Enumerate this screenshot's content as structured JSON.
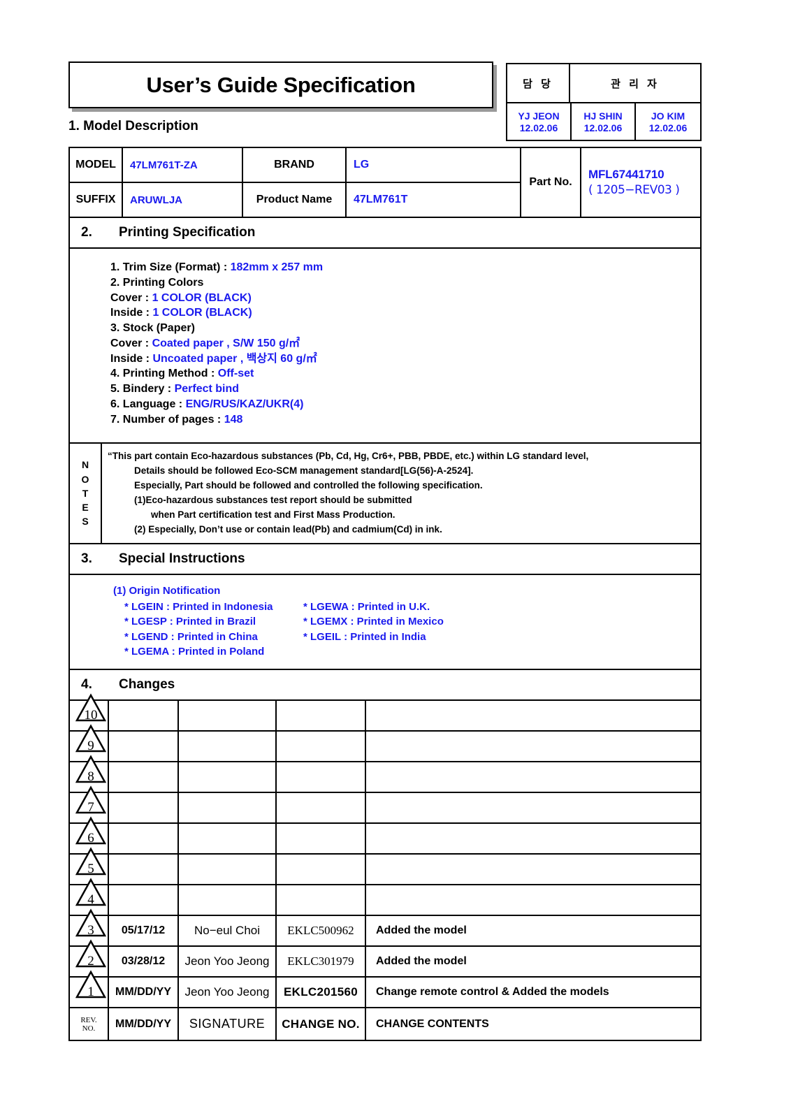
{
  "document": {
    "title": "User’s Guide Specification"
  },
  "approval": {
    "headers": [
      "담  당",
      "관 리 자"
    ],
    "people": [
      {
        "name": "YJ JEON",
        "date": "12.02.06"
      },
      {
        "name": "HJ SHIN",
        "date": "12.02.06"
      },
      {
        "name": "JO KIM",
        "date": "12.02.06"
      }
    ]
  },
  "section1": {
    "number": "1.",
    "title": "Model Description",
    "fields": {
      "model_label": "MODEL",
      "model_value": "47LM761T-ZA",
      "brand_label": "BRAND",
      "brand_value": "LG",
      "suffix_label": "SUFFIX",
      "suffix_value": "ARUWLJA",
      "product_name_label": "Product Name",
      "product_name_value": "47LM761T",
      "part_no_label": "Part No.",
      "part_no_value": "MFL67441710",
      "part_no_rev": "( 1205−REV03 )"
    }
  },
  "section2": {
    "number": "2.",
    "title": "Printing Specification",
    "lines": [
      {
        "label": "1. Trim Size (Format) : ",
        "value": "182mm x 257 mm"
      },
      {
        "label": "2. Printing Colors",
        "value": ""
      },
      {
        "label": " Cover : ",
        "value": "1 COLOR (BLACK)"
      },
      {
        "label": " Inside : ",
        "value": "1 COLOR (BLACK)"
      },
      {
        "label": "3. Stock (Paper)",
        "value": ""
      },
      {
        "label": " Cover : ",
        "value": "Coated paper , S/W 150 g/㎡"
      },
      {
        "label": " Inside : ",
        "value": "Uncoated paper , 백상지 60 g/㎡"
      },
      {
        "label": "4. Printing Method : ",
        "value": "Off-set"
      },
      {
        "label": "5. Bindery  : ",
        "value": "Perfect bind"
      },
      {
        "label": "6. Language : ",
        "value": "ENG/RUS/KAZ/UKR(4)"
      },
      {
        "label": "7. Number of pages : ",
        "value": "148"
      }
    ]
  },
  "notes": {
    "label_letters": [
      "N",
      "O",
      "T",
      "E",
      "S"
    ],
    "lines": [
      "“This part contain Eco-hazardous substances (Pb, Cd, Hg, Cr6+, PBB, PBDE, etc.) within LG standard level,",
      "Details should be followed Eco-SCM management standard[LG(56)-A-2524].",
      "Especially, Part should be followed and controlled the following specification.",
      "(1)Eco-hazardous substances test report should be submitted",
      "when  Part certification test and First Mass Production.",
      "(2) Especially, Don’t use or contain lead(Pb) and cadmium(Cd) in ink."
    ]
  },
  "section3": {
    "number": "3.",
    "title": "Special Instructions",
    "origin_heading": "(1) Origin Notification",
    "origins": [
      {
        "left": "* LGEIN : Printed in Indonesia",
        "right": "* LGEWA : Printed in U.K."
      },
      {
        "left": "* LGESP : Printed in Brazil",
        "right": "* LGEMX : Printed in Mexico"
      },
      {
        "left": "* LGEND : Printed in China",
        "right": " * LGEIL : Printed in India"
      },
      {
        "left": "* LGEMA : Printed in Poland",
        "right": ""
      }
    ]
  },
  "section4": {
    "number": "4.",
    "title": "Changes",
    "rows": [
      {
        "rev": "10",
        "date": "",
        "signature": "",
        "change_no": "",
        "contents": ""
      },
      {
        "rev": "9",
        "date": "",
        "signature": "",
        "change_no": "",
        "contents": ""
      },
      {
        "rev": "8",
        "date": "",
        "signature": "",
        "change_no": "",
        "contents": ""
      },
      {
        "rev": "7",
        "date": "",
        "signature": "",
        "change_no": "",
        "contents": ""
      },
      {
        "rev": "6",
        "date": "",
        "signature": "",
        "change_no": "",
        "contents": ""
      },
      {
        "rev": "5",
        "date": "",
        "signature": "",
        "change_no": "",
        "contents": ""
      },
      {
        "rev": "4",
        "date": "",
        "signature": "",
        "change_no": "",
        "contents": ""
      },
      {
        "rev": "3",
        "date": "05/17/12",
        "signature": "No−eul Choi",
        "change_no": "EKLC500962",
        "contents": "Added the model"
      },
      {
        "rev": "2",
        "date": "03/28/12",
        "signature": "Jeon Yoo Jeong",
        "change_no": "EKLC301979",
        "contents": "Added the model"
      },
      {
        "rev": "1",
        "date": "MM/DD/YY",
        "signature": "Jeon Yoo Jeong",
        "change_no": "EKLC201560",
        "contents": "Change remote control & Added the models"
      }
    ],
    "footer": {
      "rev_line1": "REV.",
      "rev_line2": "NO.",
      "date": "MM/DD/YY",
      "signature": "SIGNATURE",
      "change_no": "CHANGE NO.",
      "contents": "CHANGE   CONTENTS"
    }
  },
  "colors": {
    "accent_blue": "#1a1aee",
    "ink_black": "#000000",
    "shadow_gray": "#9a9a9a"
  }
}
